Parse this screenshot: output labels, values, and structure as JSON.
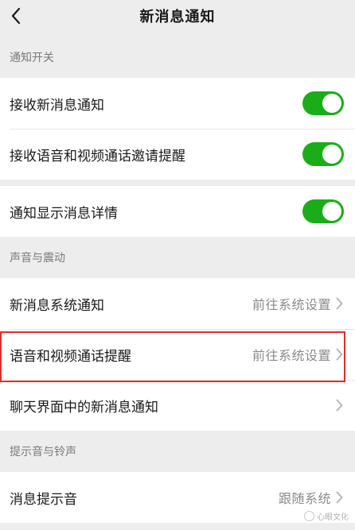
{
  "nav": {
    "title": "新消息通知"
  },
  "sections": {
    "notification_switch": {
      "header": "通知开关",
      "items": [
        {
          "label": "接收新消息通知",
          "toggle": "on"
        },
        {
          "label": "接收语音和视频通话邀请提醒",
          "toggle": "on"
        }
      ],
      "items2": [
        {
          "label": "通知显示消息详情",
          "toggle": "on"
        }
      ]
    },
    "sound_vibration": {
      "header": "声音与震动",
      "items": [
        {
          "label": "新消息系统通知",
          "value": "前往系统设置"
        },
        {
          "label": "语音和视频通话提醒",
          "value": "前往系统设置"
        },
        {
          "label": "聊天界面中的新消息通知",
          "value": ""
        }
      ]
    },
    "tone_ringtone": {
      "header": "提示音与铃声",
      "items": [
        {
          "label": "消息提示音",
          "value": "跟随系统"
        }
      ]
    }
  },
  "watermark": "心眼文化",
  "colors": {
    "toggle_on": "#1aad19",
    "highlight": "#d9302c",
    "background": "#ededed"
  },
  "icons": {
    "back": "chevron-left-icon",
    "row_arrow": "chevron-right-icon"
  }
}
